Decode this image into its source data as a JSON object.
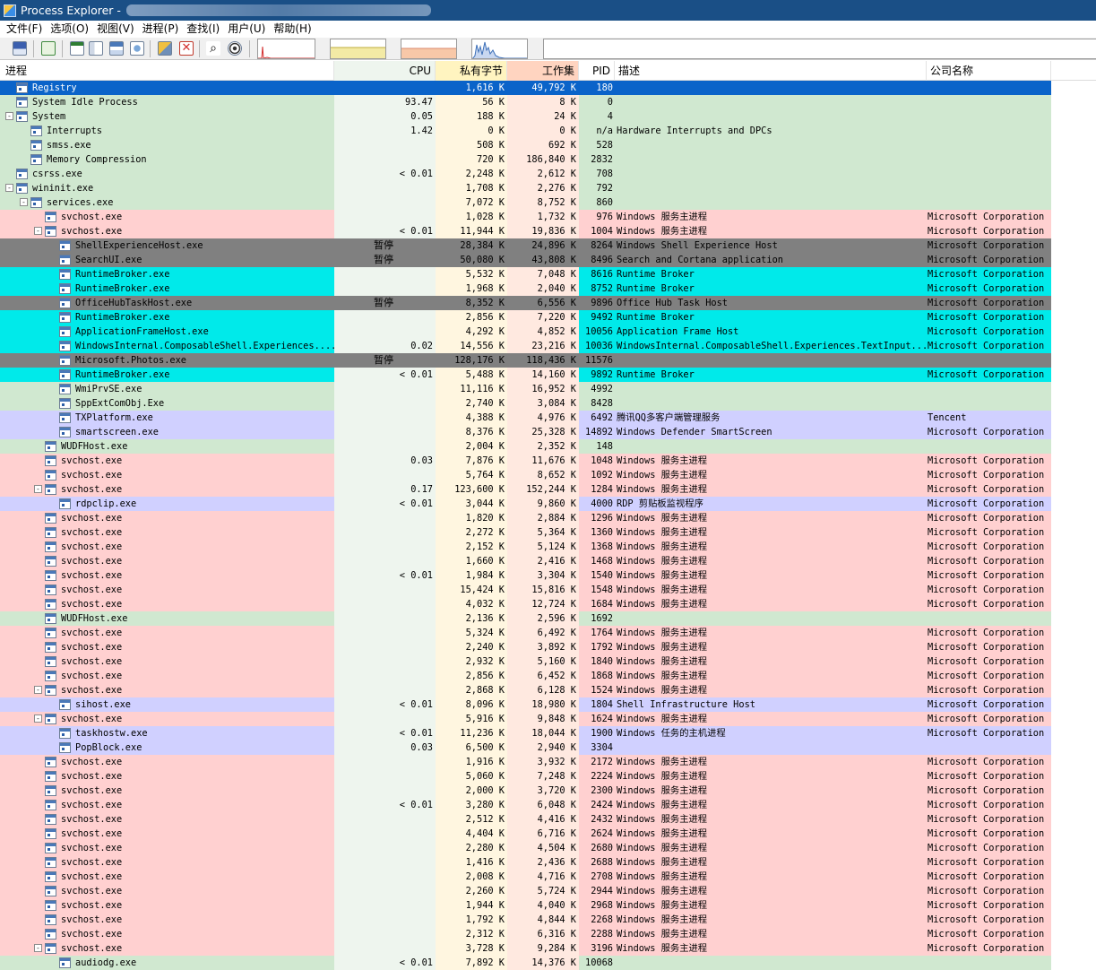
{
  "window": {
    "title": "Process Explorer - "
  },
  "menu": [
    "文件(F)",
    "选项(O)",
    "视图(V)",
    "进程(P)",
    "查找(I)",
    "用户(U)",
    "帮助(H)"
  ],
  "toolbar_icons": [
    "save-icon",
    "refresh-icon",
    "system-info-icon",
    "process-properties-icon",
    "lower-pane-icon",
    "dll-view-icon",
    "options-icon",
    "kill-process-icon",
    "find-icon",
    "target-window-icon"
  ],
  "colors": {
    "services": "#ffd0d0",
    "own_process": "#d0d0ff",
    "suspended": "#808080",
    "immersive": "#00eaea",
    "normal": "#d0e8d0",
    "selected": "#0a63c9",
    "cpu_column": "#eef5ee",
    "private_bytes_column": "#fff6e0",
    "working_set_column": "#ffe9e0",
    "header_private": "#fff4c0",
    "header_working": "#ffd4c0"
  },
  "columns": {
    "process": "进程",
    "cpu": "CPU",
    "private_bytes": "私有字节",
    "working_set": "工作集",
    "pid": "PID",
    "description": "描述",
    "company": "公司名称"
  },
  "processes": [
    {
      "name": "Registry",
      "level": 0,
      "toggle": "",
      "cpu": "",
      "priv": "1,616 K",
      "ws": "49,792 K",
      "pid": "180",
      "desc": "",
      "comp": "",
      "type": "selected"
    },
    {
      "name": "System Idle Process",
      "level": 0,
      "toggle": "",
      "cpu": "93.47",
      "priv": "56 K",
      "ws": "8 K",
      "pid": "0",
      "desc": "",
      "comp": "",
      "type": "normal"
    },
    {
      "name": "System",
      "level": 0,
      "toggle": "-",
      "cpu": "0.05",
      "priv": "188 K",
      "ws": "24 K",
      "pid": "4",
      "desc": "",
      "comp": "",
      "type": "normal"
    },
    {
      "name": "Interrupts",
      "level": 1,
      "toggle": "",
      "cpu": "1.42",
      "priv": "0 K",
      "ws": "0 K",
      "pid": "n/a",
      "desc": "Hardware Interrupts and DPCs",
      "comp": "",
      "type": "normal"
    },
    {
      "name": "smss.exe",
      "level": 1,
      "toggle": "",
      "cpu": "",
      "priv": "508 K",
      "ws": "692 K",
      "pid": "528",
      "desc": "",
      "comp": "",
      "type": "normal"
    },
    {
      "name": "Memory Compression",
      "level": 1,
      "toggle": "",
      "cpu": "",
      "priv": "720 K",
      "ws": "186,840 K",
      "pid": "2832",
      "desc": "",
      "comp": "",
      "type": "normal"
    },
    {
      "name": "csrss.exe",
      "level": 0,
      "toggle": "",
      "cpu": "< 0.01",
      "priv": "2,248 K",
      "ws": "2,612 K",
      "pid": "708",
      "desc": "",
      "comp": "",
      "type": "normal"
    },
    {
      "name": "wininit.exe",
      "level": 0,
      "toggle": "-",
      "cpu": "",
      "priv": "1,708 K",
      "ws": "2,276 K",
      "pid": "792",
      "desc": "",
      "comp": "",
      "type": "normal"
    },
    {
      "name": "services.exe",
      "level": 1,
      "toggle": "-",
      "cpu": "",
      "priv": "7,072 K",
      "ws": "8,752 K",
      "pid": "860",
      "desc": "",
      "comp": "",
      "type": "normal"
    },
    {
      "name": "svchost.exe",
      "level": 2,
      "toggle": "",
      "cpu": "",
      "priv": "1,028 K",
      "ws": "1,732 K",
      "pid": "976",
      "desc": "Windows 服务主进程",
      "comp": "Microsoft Corporation",
      "type": "services"
    },
    {
      "name": "svchost.exe",
      "level": 2,
      "toggle": "-",
      "cpu": "< 0.01",
      "priv": "11,944 K",
      "ws": "19,836 K",
      "pid": "1004",
      "desc": "Windows 服务主进程",
      "comp": "Microsoft Corporation",
      "type": "services"
    },
    {
      "name": "ShellExperienceHost.exe",
      "level": 3,
      "toggle": "",
      "cpu": "暂停",
      "priv": "28,384 K",
      "ws": "24,896 K",
      "pid": "8264",
      "desc": "Windows Shell Experience Host",
      "comp": "Microsoft Corporation",
      "type": "suspended"
    },
    {
      "name": "SearchUI.exe",
      "level": 3,
      "toggle": "",
      "cpu": "暂停",
      "priv": "50,080 K",
      "ws": "43,808 K",
      "pid": "8496",
      "desc": "Search and Cortana application",
      "comp": "Microsoft Corporation",
      "type": "suspended"
    },
    {
      "name": "RuntimeBroker.exe",
      "level": 3,
      "toggle": "",
      "cpu": "",
      "priv": "5,532 K",
      "ws": "7,048 K",
      "pid": "8616",
      "desc": "Runtime Broker",
      "comp": "Microsoft Corporation",
      "type": "immersive"
    },
    {
      "name": "RuntimeBroker.exe",
      "level": 3,
      "toggle": "",
      "cpu": "",
      "priv": "1,968 K",
      "ws": "2,040 K",
      "pid": "8752",
      "desc": "Runtime Broker",
      "comp": "Microsoft Corporation",
      "type": "immersive"
    },
    {
      "name": "OfficeHubTaskHost.exe",
      "level": 3,
      "toggle": "",
      "cpu": "暂停",
      "priv": "8,352 K",
      "ws": "6,556 K",
      "pid": "9896",
      "desc": "Office Hub Task Host",
      "comp": "Microsoft Corporation",
      "type": "suspended"
    },
    {
      "name": "RuntimeBroker.exe",
      "level": 3,
      "toggle": "",
      "cpu": "",
      "priv": "2,856 K",
      "ws": "7,220 K",
      "pid": "9492",
      "desc": "Runtime Broker",
      "comp": "Microsoft Corporation",
      "type": "immersive"
    },
    {
      "name": "ApplicationFrameHost.exe",
      "level": 3,
      "toggle": "",
      "cpu": "",
      "priv": "4,292 K",
      "ws": "4,852 K",
      "pid": "10056",
      "desc": "Application Frame Host",
      "comp": "Microsoft Corporation",
      "type": "immersive"
    },
    {
      "name": "WindowsInternal.ComposableShell.Experiences....",
      "level": 3,
      "toggle": "",
      "cpu": "0.02",
      "priv": "14,556 K",
      "ws": "23,216 K",
      "pid": "10036",
      "desc": "WindowsInternal.ComposableShell.Experiences.TextInput...",
      "comp": "Microsoft Corporation",
      "type": "immersive"
    },
    {
      "name": "Microsoft.Photos.exe",
      "level": 3,
      "toggle": "",
      "cpu": "暂停",
      "priv": "128,176 K",
      "ws": "118,436 K",
      "pid": "11576",
      "desc": "",
      "comp": "",
      "type": "suspended"
    },
    {
      "name": "RuntimeBroker.exe",
      "level": 3,
      "toggle": "",
      "cpu": "< 0.01",
      "priv": "5,488 K",
      "ws": "14,160 K",
      "pid": "9892",
      "desc": "Runtime Broker",
      "comp": "Microsoft Corporation",
      "type": "immersive"
    },
    {
      "name": "WmiPrvSE.exe",
      "level": 3,
      "toggle": "",
      "cpu": "",
      "priv": "11,116 K",
      "ws": "16,952 K",
      "pid": "4992",
      "desc": "",
      "comp": "",
      "type": "normal"
    },
    {
      "name": "SppExtComObj.Exe",
      "level": 3,
      "toggle": "",
      "cpu": "",
      "priv": "2,740 K",
      "ws": "3,084 K",
      "pid": "8428",
      "desc": "",
      "comp": "",
      "type": "normal"
    },
    {
      "name": "TXPlatform.exe",
      "level": 3,
      "toggle": "",
      "cpu": "",
      "priv": "4,388 K",
      "ws": "4,976 K",
      "pid": "6492",
      "desc": "腾讯QQ多客户端管理服务",
      "comp": "Tencent",
      "type": "own"
    },
    {
      "name": "smartscreen.exe",
      "level": 3,
      "toggle": "",
      "cpu": "",
      "priv": "8,376 K",
      "ws": "25,328 K",
      "pid": "14892",
      "desc": "Windows Defender SmartScreen",
      "comp": "Microsoft Corporation",
      "type": "own"
    },
    {
      "name": "WUDFHost.exe",
      "level": 2,
      "toggle": "",
      "cpu": "",
      "priv": "2,004 K",
      "ws": "2,352 K",
      "pid": "148",
      "desc": "",
      "comp": "",
      "type": "normal"
    },
    {
      "name": "svchost.exe",
      "level": 2,
      "toggle": "",
      "cpu": "0.03",
      "priv": "7,876 K",
      "ws": "11,676 K",
      "pid": "1048",
      "desc": "Windows 服务主进程",
      "comp": "Microsoft Corporation",
      "type": "services"
    },
    {
      "name": "svchost.exe",
      "level": 2,
      "toggle": "",
      "cpu": "",
      "priv": "5,764 K",
      "ws": "8,652 K",
      "pid": "1092",
      "desc": "Windows 服务主进程",
      "comp": "Microsoft Corporation",
      "type": "services"
    },
    {
      "name": "svchost.exe",
      "level": 2,
      "toggle": "-",
      "cpu": "0.17",
      "priv": "123,600 K",
      "ws": "152,244 K",
      "pid": "1284",
      "desc": "Windows 服务主进程",
      "comp": "Microsoft Corporation",
      "type": "services"
    },
    {
      "name": "rdpclip.exe",
      "level": 3,
      "toggle": "",
      "cpu": "< 0.01",
      "priv": "3,044 K",
      "ws": "9,860 K",
      "pid": "4000",
      "desc": "RDP 剪贴板监视程序",
      "comp": "Microsoft Corporation",
      "type": "own"
    },
    {
      "name": "svchost.exe",
      "level": 2,
      "toggle": "",
      "cpu": "",
      "priv": "1,820 K",
      "ws": "2,884 K",
      "pid": "1296",
      "desc": "Windows 服务主进程",
      "comp": "Microsoft Corporation",
      "type": "services"
    },
    {
      "name": "svchost.exe",
      "level": 2,
      "toggle": "",
      "cpu": "",
      "priv": "2,272 K",
      "ws": "5,364 K",
      "pid": "1360",
      "desc": "Windows 服务主进程",
      "comp": "Microsoft Corporation",
      "type": "services"
    },
    {
      "name": "svchost.exe",
      "level": 2,
      "toggle": "",
      "cpu": "",
      "priv": "2,152 K",
      "ws": "5,124 K",
      "pid": "1368",
      "desc": "Windows 服务主进程",
      "comp": "Microsoft Corporation",
      "type": "services"
    },
    {
      "name": "svchost.exe",
      "level": 2,
      "toggle": "",
      "cpu": "",
      "priv": "1,660 K",
      "ws": "2,416 K",
      "pid": "1468",
      "desc": "Windows 服务主进程",
      "comp": "Microsoft Corporation",
      "type": "services"
    },
    {
      "name": "svchost.exe",
      "level": 2,
      "toggle": "",
      "cpu": "< 0.01",
      "priv": "1,984 K",
      "ws": "3,304 K",
      "pid": "1540",
      "desc": "Windows 服务主进程",
      "comp": "Microsoft Corporation",
      "type": "services"
    },
    {
      "name": "svchost.exe",
      "level": 2,
      "toggle": "",
      "cpu": "",
      "priv": "15,424 K",
      "ws": "15,816 K",
      "pid": "1548",
      "desc": "Windows 服务主进程",
      "comp": "Microsoft Corporation",
      "type": "services"
    },
    {
      "name": "svchost.exe",
      "level": 2,
      "toggle": "",
      "cpu": "",
      "priv": "4,032 K",
      "ws": "12,724 K",
      "pid": "1684",
      "desc": "Windows 服务主进程",
      "comp": "Microsoft Corporation",
      "type": "services"
    },
    {
      "name": "WUDFHost.exe",
      "level": 2,
      "toggle": "",
      "cpu": "",
      "priv": "2,136 K",
      "ws": "2,596 K",
      "pid": "1692",
      "desc": "",
      "comp": "",
      "type": "normal"
    },
    {
      "name": "svchost.exe",
      "level": 2,
      "toggle": "",
      "cpu": "",
      "priv": "5,324 K",
      "ws": "6,492 K",
      "pid": "1764",
      "desc": "Windows 服务主进程",
      "comp": "Microsoft Corporation",
      "type": "services"
    },
    {
      "name": "svchost.exe",
      "level": 2,
      "toggle": "",
      "cpu": "",
      "priv": "2,240 K",
      "ws": "3,892 K",
      "pid": "1792",
      "desc": "Windows 服务主进程",
      "comp": "Microsoft Corporation",
      "type": "services"
    },
    {
      "name": "svchost.exe",
      "level": 2,
      "toggle": "",
      "cpu": "",
      "priv": "2,932 K",
      "ws": "5,160 K",
      "pid": "1840",
      "desc": "Windows 服务主进程",
      "comp": "Microsoft Corporation",
      "type": "services"
    },
    {
      "name": "svchost.exe",
      "level": 2,
      "toggle": "",
      "cpu": "",
      "priv": "2,856 K",
      "ws": "6,452 K",
      "pid": "1868",
      "desc": "Windows 服务主进程",
      "comp": "Microsoft Corporation",
      "type": "services"
    },
    {
      "name": "svchost.exe",
      "level": 2,
      "toggle": "-",
      "cpu": "",
      "priv": "2,868 K",
      "ws": "6,128 K",
      "pid": "1524",
      "desc": "Windows 服务主进程",
      "comp": "Microsoft Corporation",
      "type": "services"
    },
    {
      "name": "sihost.exe",
      "level": 3,
      "toggle": "",
      "cpu": "< 0.01",
      "priv": "8,096 K",
      "ws": "18,980 K",
      "pid": "1804",
      "desc": "Shell Infrastructure Host",
      "comp": "Microsoft Corporation",
      "type": "own"
    },
    {
      "name": "svchost.exe",
      "level": 2,
      "toggle": "-",
      "cpu": "",
      "priv": "5,916 K",
      "ws": "9,848 K",
      "pid": "1624",
      "desc": "Windows 服务主进程",
      "comp": "Microsoft Corporation",
      "type": "services"
    },
    {
      "name": "taskhostw.exe",
      "level": 3,
      "toggle": "",
      "cpu": "< 0.01",
      "priv": "11,236 K",
      "ws": "18,044 K",
      "pid": "1900",
      "desc": "Windows 任务的主机进程",
      "comp": "Microsoft Corporation",
      "type": "own"
    },
    {
      "name": "PopBlock.exe",
      "level": 3,
      "toggle": "",
      "cpu": "0.03",
      "priv": "6,500 K",
      "ws": "2,940 K",
      "pid": "3304",
      "desc": "",
      "comp": "",
      "type": "own"
    },
    {
      "name": "svchost.exe",
      "level": 2,
      "toggle": "",
      "cpu": "",
      "priv": "1,916 K",
      "ws": "3,932 K",
      "pid": "2172",
      "desc": "Windows 服务主进程",
      "comp": "Microsoft Corporation",
      "type": "services"
    },
    {
      "name": "svchost.exe",
      "level": 2,
      "toggle": "",
      "cpu": "",
      "priv": "5,060 K",
      "ws": "7,248 K",
      "pid": "2224",
      "desc": "Windows 服务主进程",
      "comp": "Microsoft Corporation",
      "type": "services"
    },
    {
      "name": "svchost.exe",
      "level": 2,
      "toggle": "",
      "cpu": "",
      "priv": "2,000 K",
      "ws": "3,720 K",
      "pid": "2300",
      "desc": "Windows 服务主进程",
      "comp": "Microsoft Corporation",
      "type": "services"
    },
    {
      "name": "svchost.exe",
      "level": 2,
      "toggle": "",
      "cpu": "< 0.01",
      "priv": "3,280 K",
      "ws": "6,048 K",
      "pid": "2424",
      "desc": "Windows 服务主进程",
      "comp": "Microsoft Corporation",
      "type": "services"
    },
    {
      "name": "svchost.exe",
      "level": 2,
      "toggle": "",
      "cpu": "",
      "priv": "2,512 K",
      "ws": "4,416 K",
      "pid": "2432",
      "desc": "Windows 服务主进程",
      "comp": "Microsoft Corporation",
      "type": "services"
    },
    {
      "name": "svchost.exe",
      "level": 2,
      "toggle": "",
      "cpu": "",
      "priv": "4,404 K",
      "ws": "6,716 K",
      "pid": "2624",
      "desc": "Windows 服务主进程",
      "comp": "Microsoft Corporation",
      "type": "services"
    },
    {
      "name": "svchost.exe",
      "level": 2,
      "toggle": "",
      "cpu": "",
      "priv": "2,280 K",
      "ws": "4,504 K",
      "pid": "2680",
      "desc": "Windows 服务主进程",
      "comp": "Microsoft Corporation",
      "type": "services"
    },
    {
      "name": "svchost.exe",
      "level": 2,
      "toggle": "",
      "cpu": "",
      "priv": "1,416 K",
      "ws": "2,436 K",
      "pid": "2688",
      "desc": "Windows 服务主进程",
      "comp": "Microsoft Corporation",
      "type": "services"
    },
    {
      "name": "svchost.exe",
      "level": 2,
      "toggle": "",
      "cpu": "",
      "priv": "2,008 K",
      "ws": "4,716 K",
      "pid": "2708",
      "desc": "Windows 服务主进程",
      "comp": "Microsoft Corporation",
      "type": "services"
    },
    {
      "name": "svchost.exe",
      "level": 2,
      "toggle": "",
      "cpu": "",
      "priv": "2,260 K",
      "ws": "5,724 K",
      "pid": "2944",
      "desc": "Windows 服务主进程",
      "comp": "Microsoft Corporation",
      "type": "services"
    },
    {
      "name": "svchost.exe",
      "level": 2,
      "toggle": "",
      "cpu": "",
      "priv": "1,944 K",
      "ws": "4,040 K",
      "pid": "2968",
      "desc": "Windows 服务主进程",
      "comp": "Microsoft Corporation",
      "type": "services"
    },
    {
      "name": "svchost.exe",
      "level": 2,
      "toggle": "",
      "cpu": "",
      "priv": "1,792 K",
      "ws": "4,844 K",
      "pid": "2268",
      "desc": "Windows 服务主进程",
      "comp": "Microsoft Corporation",
      "type": "services"
    },
    {
      "name": "svchost.exe",
      "level": 2,
      "toggle": "",
      "cpu": "",
      "priv": "2,312 K",
      "ws": "6,316 K",
      "pid": "2288",
      "desc": "Windows 服务主进程",
      "comp": "Microsoft Corporation",
      "type": "services"
    },
    {
      "name": "svchost.exe",
      "level": 2,
      "toggle": "-",
      "cpu": "",
      "priv": "3,728 K",
      "ws": "9,284 K",
      "pid": "3196",
      "desc": "Windows 服务主进程",
      "comp": "Microsoft Corporation",
      "type": "services"
    },
    {
      "name": "audiodg.exe",
      "level": 3,
      "toggle": "",
      "cpu": "< 0.01",
      "priv": "7,892 K",
      "ws": "14,376 K",
      "pid": "10068",
      "desc": "",
      "comp": "",
      "type": "normal"
    }
  ]
}
